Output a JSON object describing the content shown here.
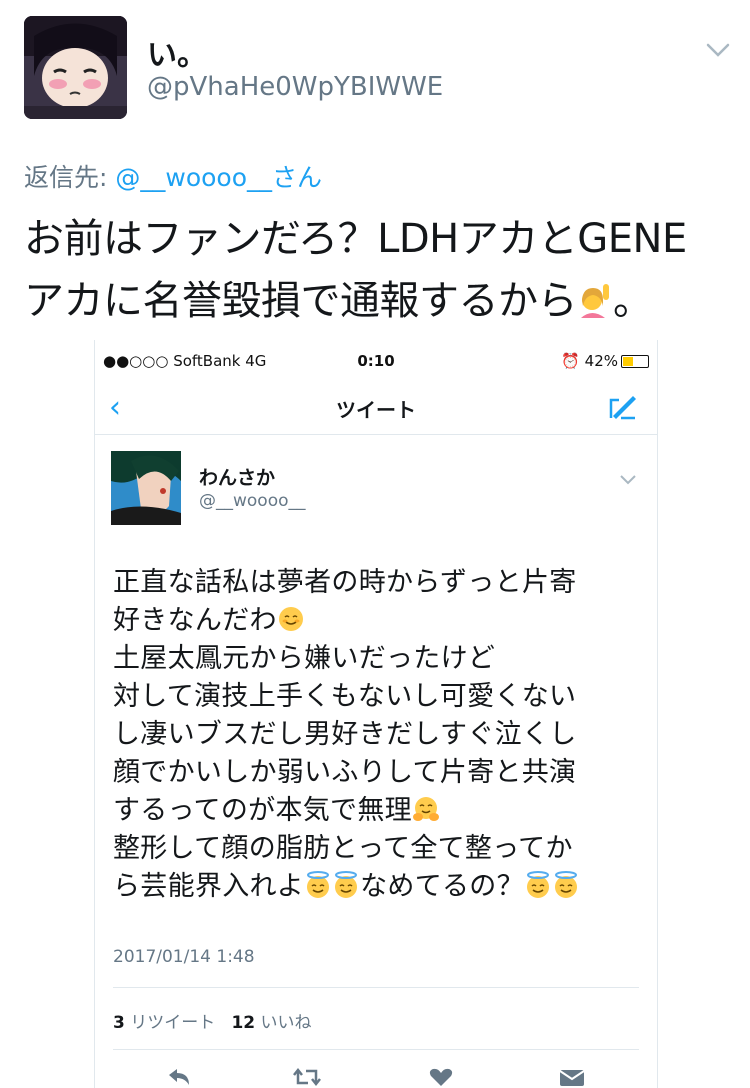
{
  "tweet": {
    "display_name": "い。",
    "handle": "@pVhaHe0WpYBIWWE",
    "reply_prefix": "返信先: ",
    "reply_mention": "@__woooo__さん",
    "text_line1": "お前はファンだろ？LDHアカとGENE",
    "text_line2a": "アカに名誉毀損で通報するから",
    "text_line2b": "。"
  },
  "screenshot": {
    "status": {
      "carrier": "●●○○○ SoftBank  4G",
      "time": "0:10",
      "battery": "42%",
      "battery_level": 0.42
    },
    "nav_title": "ツイート",
    "inner_tweet": {
      "display_name": "わんさか",
      "handle": "@__woooo__",
      "lines": [
        "正直な話私は夢者の時からずっと片寄",
        "好きなんだわ",
        "土屋太鳳元から嫌いだったけど",
        "対して演技上手くもないし可愛くない",
        "し凄いブスだし男好きだしすぐ泣くし",
        "顔でかいしか弱いふりして片寄と共演",
        "するってのが本気で無理",
        "整形して顔の脂肪とって全て整ってか",
        "ら芸能界入れよ",
        "なめてるの？"
      ],
      "date": "2017/01/14 1:48",
      "retweet_count": "3",
      "retweet_label": "リツイート",
      "like_count": "12",
      "like_label": "いいね"
    }
  },
  "colors": {
    "accent": "#1da1f2",
    "secondary_text": "#657786",
    "divider": "#e1e8ed"
  }
}
